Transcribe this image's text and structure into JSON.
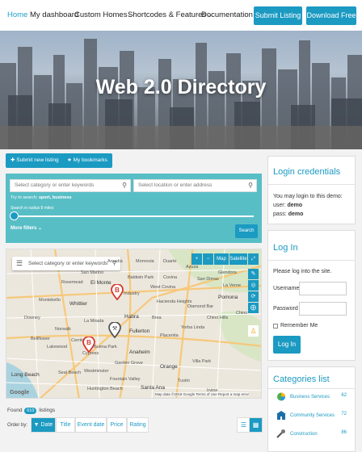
{
  "nav": {
    "items": [
      "Home",
      "My dashboard",
      "Custom Homes",
      "Shortcodes & Features",
      "Documentation"
    ],
    "submit_listing": "Submit Listing",
    "download_free": "Download Free"
  },
  "hero": {
    "title": "Web 2.0 Directory"
  },
  "actions": {
    "submit_new": "Submit new listing",
    "bookmarks": "My bookmarks"
  },
  "search": {
    "category_placeholder": "Select category or enter keywords",
    "location_placeholder": "Select location or enter address",
    "try_label": "Try to search:",
    "try_terms": "sport, business",
    "radius_label": "Search in radius 8 miles",
    "more_filters": "More filters",
    "search_button": "Search"
  },
  "map": {
    "search_placeholder": "Select category or enter keywords",
    "map_label": "Map",
    "satellite_label": "Satellite",
    "zoom_in": "+",
    "zoom_out": "−",
    "places": [
      "Arcadia",
      "Monrovia",
      "Duarte",
      "Azusa",
      "Glendora",
      "San Marino",
      "Rosemead",
      "El Monte",
      "Baldwin Park",
      "Covina",
      "West Covina",
      "San Dimas",
      "La Verne",
      "Industry",
      "Pomona",
      "Montebello",
      "Whittier",
      "Hacienda Heights",
      "Diamond Bar",
      "Chino Hills",
      "Chino",
      "Downey",
      "La Mirada",
      "Habra",
      "Brea",
      "Norwalk",
      "Bellflower",
      "Fullerton",
      "Yorba Linda",
      "Lakewood",
      "Cerritos",
      "Buena Park",
      "Anaheim",
      "Placentia",
      "Long Beach",
      "Cypress",
      "Garden Grove",
      "Orange",
      "Santa Ana",
      "Tustin",
      "Irvine",
      "Seal Beach",
      "Huntington Beach",
      "Fountain Valley",
      "Westminster",
      "Villa Park"
    ],
    "attribution": "Map data ©2019 Google   Terms of Use   Report a map error",
    "google_logo": "Google"
  },
  "results": {
    "found_prefix": "Found",
    "found_count": "610",
    "found_suffix": "listings",
    "order_label": "Order by:",
    "order_options": [
      "Date",
      "Title",
      "Event date",
      "Price",
      "Rating"
    ]
  },
  "sidebar": {
    "login_credentials": {
      "title": "Login credentials",
      "intro": "You may login to this demo:",
      "user_label": "user:",
      "user_value": "demo",
      "pass_label": "pass:",
      "pass_value": "demo"
    },
    "login": {
      "title": "Log In",
      "intro": "Please log into the site.",
      "username_label": "Username",
      "password_label": "Password",
      "remember_label": "Remember Me",
      "button": "Log In"
    },
    "categories": {
      "title": "Categories list",
      "items": [
        {
          "label": "Business Services",
          "count": "62"
        },
        {
          "label": "Community Services",
          "count": "72"
        },
        {
          "label": "Construction",
          "count": "86"
        }
      ]
    }
  },
  "colors": {
    "accent": "#1b9ac2",
    "search_panel": "#58bec6",
    "pin": "#d7372b"
  }
}
